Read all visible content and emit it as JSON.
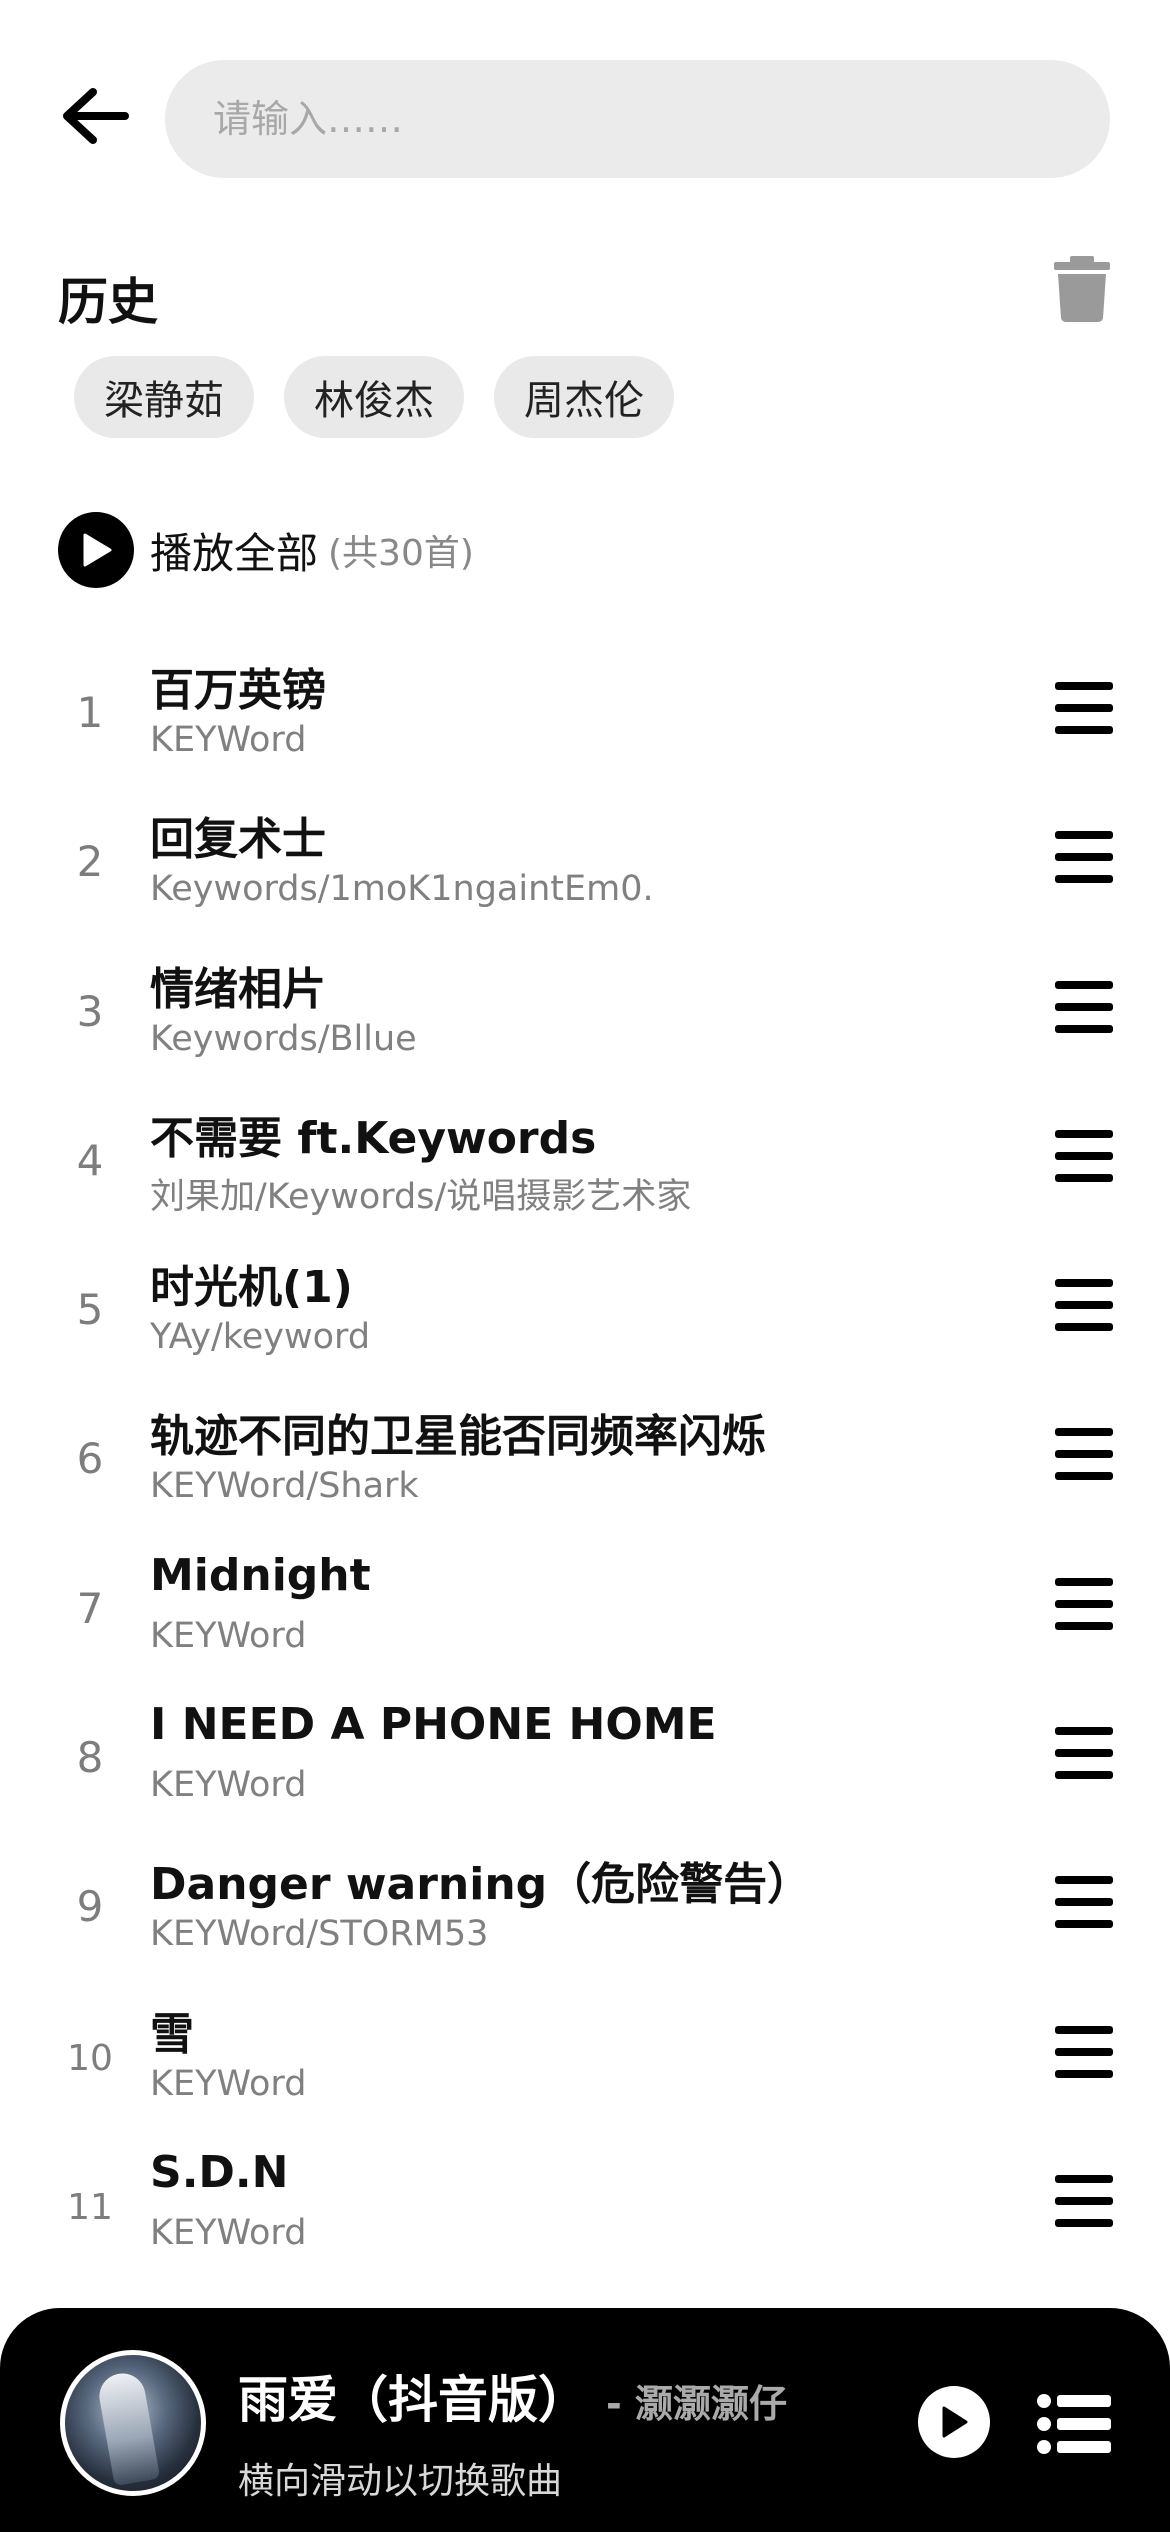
{
  "search": {
    "placeholder": "请输入……"
  },
  "history": {
    "title": "历史",
    "chips": [
      "梁静茹",
      "林俊杰",
      "周杰伦"
    ]
  },
  "play_all": {
    "label": "播放全部",
    "count": "(共30首)"
  },
  "songs": [
    {
      "index": "1",
      "title": "百万英镑",
      "artist": "KEYWord"
    },
    {
      "index": "2",
      "title": "回复术士",
      "artist": "Keywords/1moK1ngaintEm0."
    },
    {
      "index": "3",
      "title": "情绪相片",
      "artist": "Keywords/Bllue"
    },
    {
      "index": "4",
      "title": "不需要 ft.Keywords",
      "artist": "刘果加/Keywords/说唱摄影艺术家"
    },
    {
      "index": "5",
      "title": "时光机(1)",
      "artist": "YAy/keyword"
    },
    {
      "index": "6",
      "title": "轨迹不同的卫星能否同频率闪烁",
      "artist": "KEYWord/Shark"
    },
    {
      "index": "7",
      "title": "Midnight",
      "artist": "KEYWord"
    },
    {
      "index": "8",
      "title": "I NEED A PHONE HOME",
      "artist": "KEYWord"
    },
    {
      "index": "9",
      "title": "Danger warning（危险警告）",
      "artist": "KEYWord/STORM53"
    },
    {
      "index": "10",
      "title": "雪",
      "artist": "KEYWord"
    },
    {
      "index": "11",
      "title": "S.D.N",
      "artist": "KEYWord"
    }
  ],
  "player": {
    "title": "雨爱（抖音版）",
    "artist": "- 灏灏灏仔",
    "hint": "横向滑动以切换歌曲"
  },
  "icons": {
    "back": "arrow-left-icon",
    "trash": "trash-icon",
    "play_all": "play-circle-icon",
    "row_menu": "hamburger-menu-icon",
    "player_play": "play-icon",
    "player_list": "playlist-icon"
  }
}
